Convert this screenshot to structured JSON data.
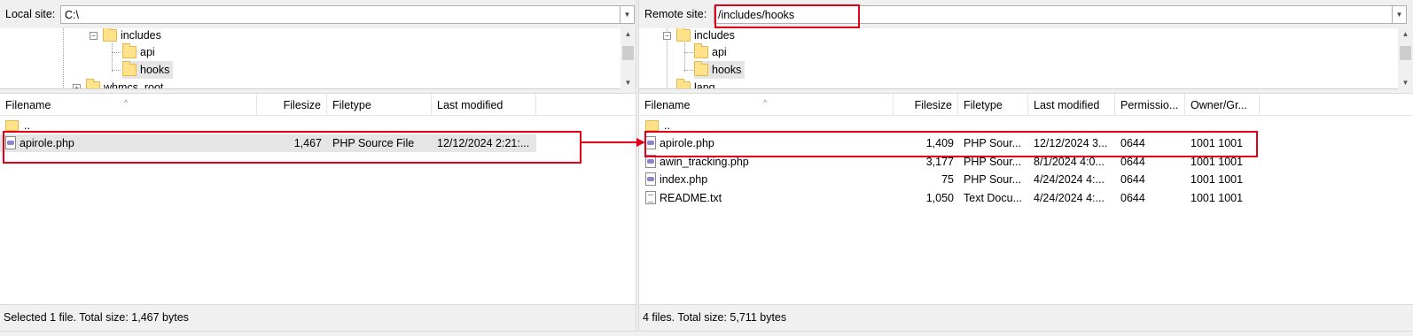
{
  "left": {
    "site_label": "Local site:",
    "site_path": "C:\\",
    "tree": [
      {
        "label": "includes"
      },
      {
        "label": "api"
      },
      {
        "label": "hooks"
      },
      {
        "label": "whmcs_root"
      }
    ],
    "columns": [
      "Filename",
      "Filesize",
      "Filetype",
      "Last modified"
    ],
    "rows": [
      {
        "name": ".."
      },
      {
        "name": "apirole.php",
        "size": "1,467",
        "type": "PHP Source File",
        "modified": "12/12/2024 2:21:..."
      }
    ],
    "status": "Selected 1 file. Total size: 1,467 bytes"
  },
  "right": {
    "site_label": "Remote site:",
    "site_path": "/includes/hooks",
    "tree": [
      {
        "label": "includes"
      },
      {
        "label": "api"
      },
      {
        "label": "hooks"
      },
      {
        "label": "lang"
      }
    ],
    "columns": [
      "Filename",
      "Filesize",
      "Filetype",
      "Last modified",
      "Permissio...",
      "Owner/Gr..."
    ],
    "rows": [
      {
        "name": ".."
      },
      {
        "name": "apirole.php",
        "size": "1,409",
        "type": "PHP Sour...",
        "modified": "12/12/2024 3...",
        "perms": "0644",
        "owner": "1001 1001"
      },
      {
        "name": "awin_tracking.php",
        "size": "3,177",
        "type": "PHP Sour...",
        "modified": "8/1/2024 4:0...",
        "perms": "0644",
        "owner": "1001 1001"
      },
      {
        "name": "index.php",
        "size": "75",
        "type": "PHP Sour...",
        "modified": "4/24/2024 4:...",
        "perms": "0644",
        "owner": "1001 1001"
      },
      {
        "name": "README.txt",
        "size": "1,050",
        "type": "Text Docu...",
        "modified": "4/24/2024 4:...",
        "perms": "0644",
        "owner": "1001 1001"
      }
    ],
    "status": "4 files. Total size: 5,711 bytes"
  },
  "icons": {
    "folder": "folder-icon",
    "php_file": "php-file-icon",
    "text_file": "text-file-icon",
    "expander": "tree-expander-icon"
  },
  "colors": {
    "highlight": "#e3001b",
    "selection": "#e5e5e5",
    "chrome": "#f0f0f0"
  }
}
